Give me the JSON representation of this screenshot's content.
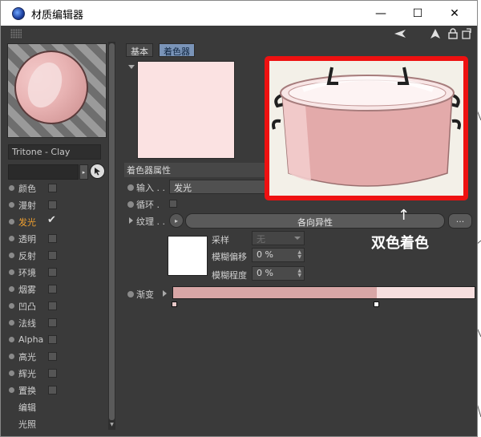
{
  "window": {
    "title": "材质编辑器",
    "minimize": "—",
    "maximize": "☐",
    "close": "✕"
  },
  "toolbar": {
    "icons": [
      "back-arrow-icon",
      "cursor-icon",
      "lock-icon",
      "expand-icon"
    ]
  },
  "material": {
    "name": "Tritone - Clay",
    "channels": [
      {
        "label": "颜色",
        "checked": false,
        "active": false
      },
      {
        "label": "漫射",
        "checked": false,
        "active": false
      },
      {
        "label": "发光",
        "checked": true,
        "active": true
      },
      {
        "label": "透明",
        "checked": false,
        "active": false
      },
      {
        "label": "反射",
        "checked": false,
        "active": false
      },
      {
        "label": "环境",
        "checked": false,
        "active": false
      },
      {
        "label": "烟雾",
        "checked": false,
        "active": false
      },
      {
        "label": "凹凸",
        "checked": false,
        "active": false
      },
      {
        "label": "法线",
        "checked": false,
        "active": false
      },
      {
        "label": "Alpha",
        "checked": false,
        "active": false
      },
      {
        "label": "高光",
        "checked": false,
        "active": false
      },
      {
        "label": "辉光",
        "checked": false,
        "active": false
      },
      {
        "label": "置换",
        "checked": false,
        "active": false
      },
      {
        "label": "编辑",
        "checked": null,
        "active": false
      },
      {
        "label": "光照",
        "checked": null,
        "active": false
      }
    ]
  },
  "tabs": {
    "basic": "基本",
    "shader": "着色器"
  },
  "shader_props": {
    "section_title": "着色器属性",
    "input_label": "输入 . .",
    "input_value": "发光",
    "loop_label": "循环 .",
    "texture_label": "纹理 . .",
    "texture_arrow": "▸",
    "texture_value": "各向异性",
    "texture_more": "...",
    "sampling_label": "采样",
    "sampling_value": "无",
    "blur_offset_label": "模糊偏移",
    "blur_offset_value": "0 %",
    "blur_amount_label": "模糊程度",
    "blur_amount_value": "0 %",
    "gradient_label": "渐变",
    "gradient_split": 0.675,
    "gradient_colors": [
      "#d8a6a6",
      "#f6dede"
    ]
  },
  "annotation": {
    "arrow": "↑",
    "text": "双色着色",
    "border_color": "#ee1111"
  },
  "colors": {
    "panel_bg": "#3a3a3a",
    "active_channel": "#f0a030",
    "tab_active": "#7a94b8",
    "preview_pink": "#fbe2e2"
  }
}
